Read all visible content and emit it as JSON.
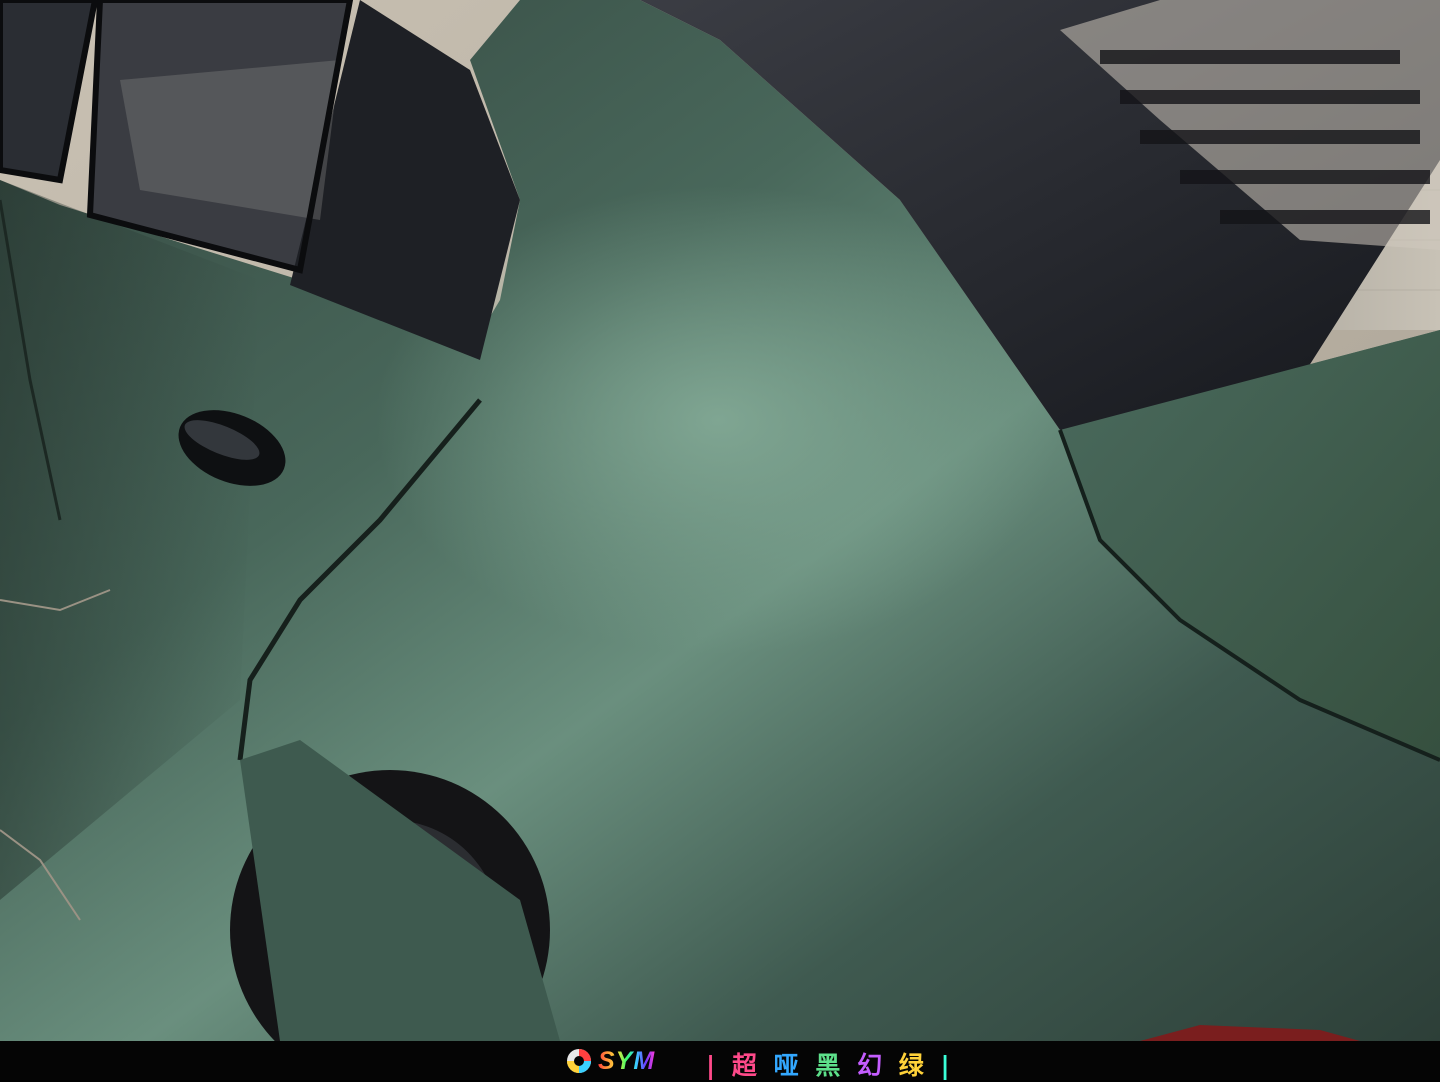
{
  "footer": {
    "brand": "SYM",
    "caption_prefix": "|",
    "caption_chars": [
      "超",
      "哑",
      "黑",
      "幻",
      "绿"
    ],
    "caption_suffix": "|",
    "caption_colors": [
      "#ff4a8a",
      "#33a8ff",
      "#5de08a",
      "#c45dff",
      "#ffd23a",
      "#ff6a3a",
      "#3affd8"
    ]
  },
  "colors": {
    "car_body": "#3f5a50",
    "car_highlight": "#6f9583",
    "pavement": "#b9b1a3",
    "building": "#a9a49b"
  },
  "icons": [
    "sym-logo-icon"
  ]
}
